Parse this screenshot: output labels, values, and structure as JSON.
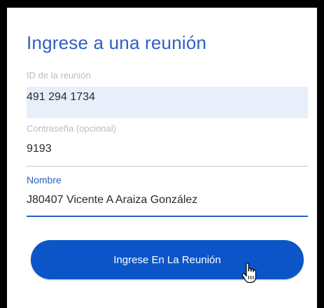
{
  "dialog": {
    "title": "Ingrese a una reunión"
  },
  "fields": {
    "meeting_id": {
      "label": "ID de la reunión",
      "value": "491 294 1734"
    },
    "password": {
      "label": "Contraseña (opcional)",
      "value": "9193"
    },
    "name": {
      "label": "Nombre",
      "value": "J80407 Vicente A Araiza González"
    }
  },
  "join_button": {
    "label": "Ingrese En La Reunión"
  },
  "cursor": {
    "icon": "hand-pointer-icon"
  },
  "colors": {
    "accent": "#2f5fc4",
    "button": "#0b55c8",
    "autofill_bg": "#e8effb",
    "label_muted": "#b7bcc4",
    "frame": "#000000"
  }
}
